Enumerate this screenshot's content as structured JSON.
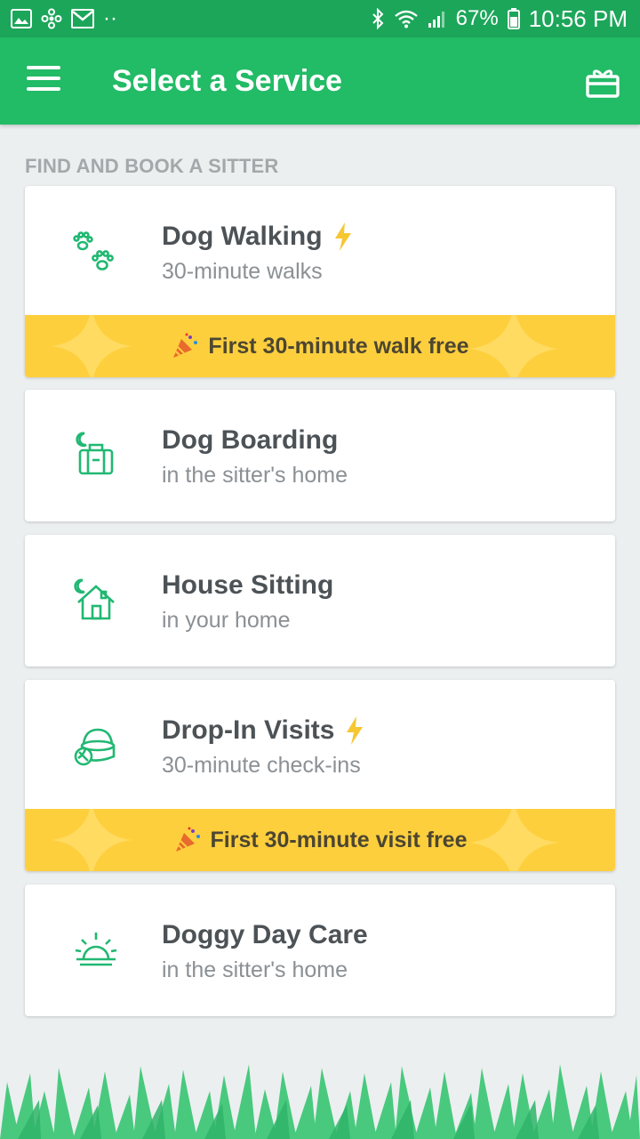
{
  "status_bar": {
    "battery": "67%",
    "time": "10:56 PM",
    "dots": "··"
  },
  "app_bar": {
    "title": "Select a Service",
    "menu_icon": "hamburger-menu-icon",
    "gift_icon": "gift-icon"
  },
  "section": {
    "header": "FIND AND BOOK A SITTER"
  },
  "services": [
    {
      "title": "Dog Walking",
      "subtitle": "30-minute walks",
      "icon": "paw-prints-icon",
      "instant": true,
      "promo": "First 30-minute walk free"
    },
    {
      "title": "Dog Boarding",
      "subtitle": "in the sitter's home",
      "icon": "suitcase-moon-icon",
      "instant": false
    },
    {
      "title": "House Sitting",
      "subtitle": "in your home",
      "icon": "house-moon-icon",
      "instant": false
    },
    {
      "title": "Drop-In Visits",
      "subtitle": "30-minute check-ins",
      "icon": "food-bowl-icon",
      "instant": true,
      "promo": "First 30-minute visit free"
    },
    {
      "title": "Doggy Day Care",
      "subtitle": "in the sitter's home",
      "icon": "sun-icon",
      "instant": false
    }
  ],
  "colors": {
    "status_bar": "#1ca65a",
    "app_bar": "#22bb66",
    "icon_green": "#21b872",
    "promo_yellow": "#fecf3d",
    "bolt_yellow": "#f5c733"
  }
}
